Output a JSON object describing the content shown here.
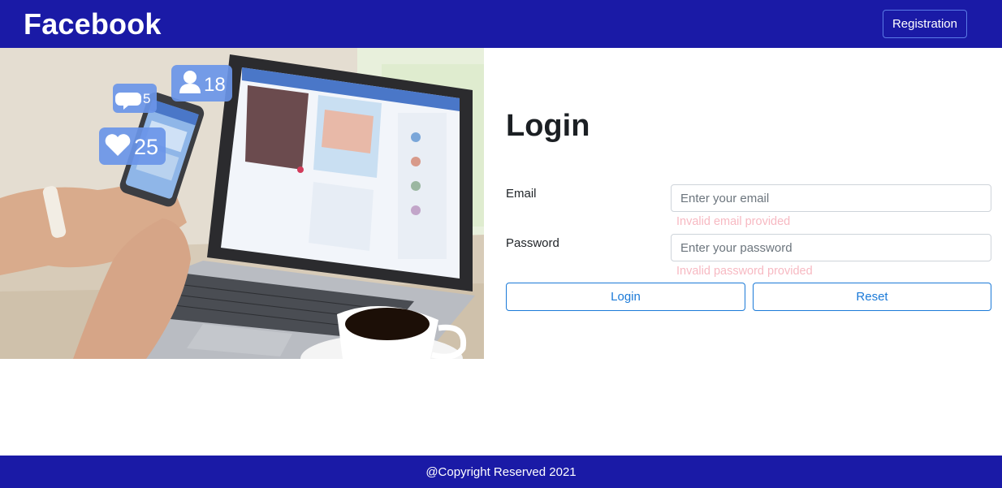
{
  "navbar": {
    "brand": "Facebook",
    "registration_label": "Registration",
    "color": "#1a1aa6"
  },
  "hero": {
    "badges": {
      "comments": "5",
      "friends": "18",
      "likes": "25"
    },
    "icons": [
      "comment-bubble-icon",
      "user-icon",
      "heart-icon"
    ]
  },
  "login": {
    "title": "Login",
    "email": {
      "label": "Email",
      "placeholder": "Enter your email",
      "value": "",
      "error": "Invalid email provided"
    },
    "password": {
      "label": "Password",
      "placeholder": "Enter your password",
      "value": "",
      "error": "Invalid password provided"
    },
    "login_button": "Login",
    "reset_button": "Reset",
    "accent_color": "#1b7ad8",
    "error_color": "#f7b9c2"
  },
  "footer": {
    "text": "@Copyright Reserved 2021"
  }
}
